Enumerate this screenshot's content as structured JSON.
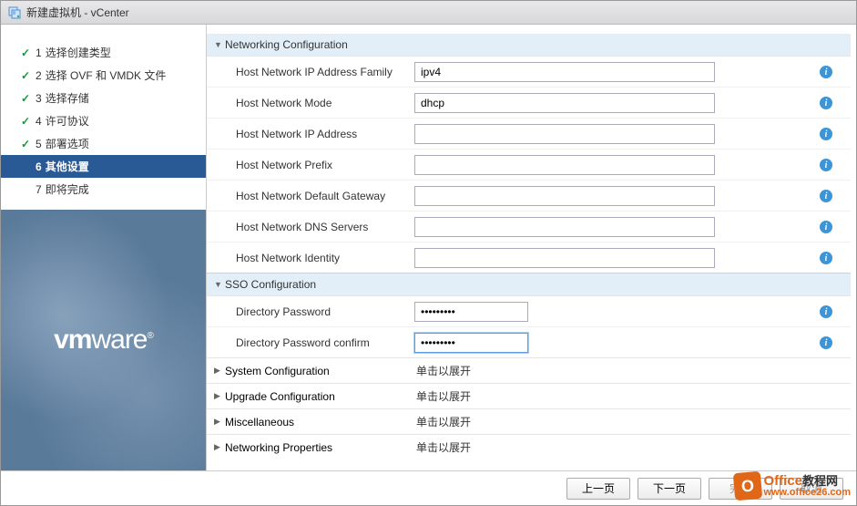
{
  "window": {
    "title": "新建虚拟机 - vCenter"
  },
  "steps": [
    {
      "num": "1",
      "label": "选择创建类型",
      "state": "completed"
    },
    {
      "num": "2",
      "label": "选择 OVF 和 VMDK 文件",
      "state": "completed"
    },
    {
      "num": "3",
      "label": "选择存储",
      "state": "completed"
    },
    {
      "num": "4",
      "label": "许可协议",
      "state": "completed"
    },
    {
      "num": "5",
      "label": "部署选项",
      "state": "completed"
    },
    {
      "num": "6",
      "label": "其他设置",
      "state": "active"
    },
    {
      "num": "7",
      "label": "即将完成",
      "state": "pending"
    }
  ],
  "logo": "vmware",
  "networking": {
    "title": "Networking Configuration",
    "fields": {
      "ip_family": {
        "label": "Host Network IP Address Family",
        "value": "ipv4"
      },
      "mode": {
        "label": "Host Network Mode",
        "value": "dhcp"
      },
      "ip_addr": {
        "label": "Host Network IP Address",
        "value": ""
      },
      "prefix": {
        "label": "Host Network Prefix",
        "value": ""
      },
      "gateway": {
        "label": "Host Network Default Gateway",
        "value": ""
      },
      "dns": {
        "label": "Host Network DNS Servers",
        "value": ""
      },
      "identity": {
        "label": "Host Network Identity",
        "value": ""
      }
    }
  },
  "sso": {
    "title": "SSO Configuration",
    "fields": {
      "password": {
        "label": "Directory Password",
        "value": "•••••••••"
      },
      "password_confirm": {
        "label": "Directory Password confirm",
        "value": "•••••••••"
      }
    }
  },
  "collapsed_sections": {
    "system": {
      "label": "System Configuration",
      "hint": "单击以展开"
    },
    "upgrade": {
      "label": "Upgrade Configuration",
      "hint": "单击以展开"
    },
    "misc": {
      "label": "Miscellaneous",
      "hint": "单击以展开"
    },
    "netprops": {
      "label": "Networking Properties",
      "hint": "单击以展开"
    }
  },
  "footer": {
    "prev": "上一页",
    "next": "下一页",
    "finish": "完成",
    "cancel": "取消"
  },
  "watermark": {
    "brand": "Office",
    "brand_cn": "教程网",
    "url": "www.office26.com"
  }
}
